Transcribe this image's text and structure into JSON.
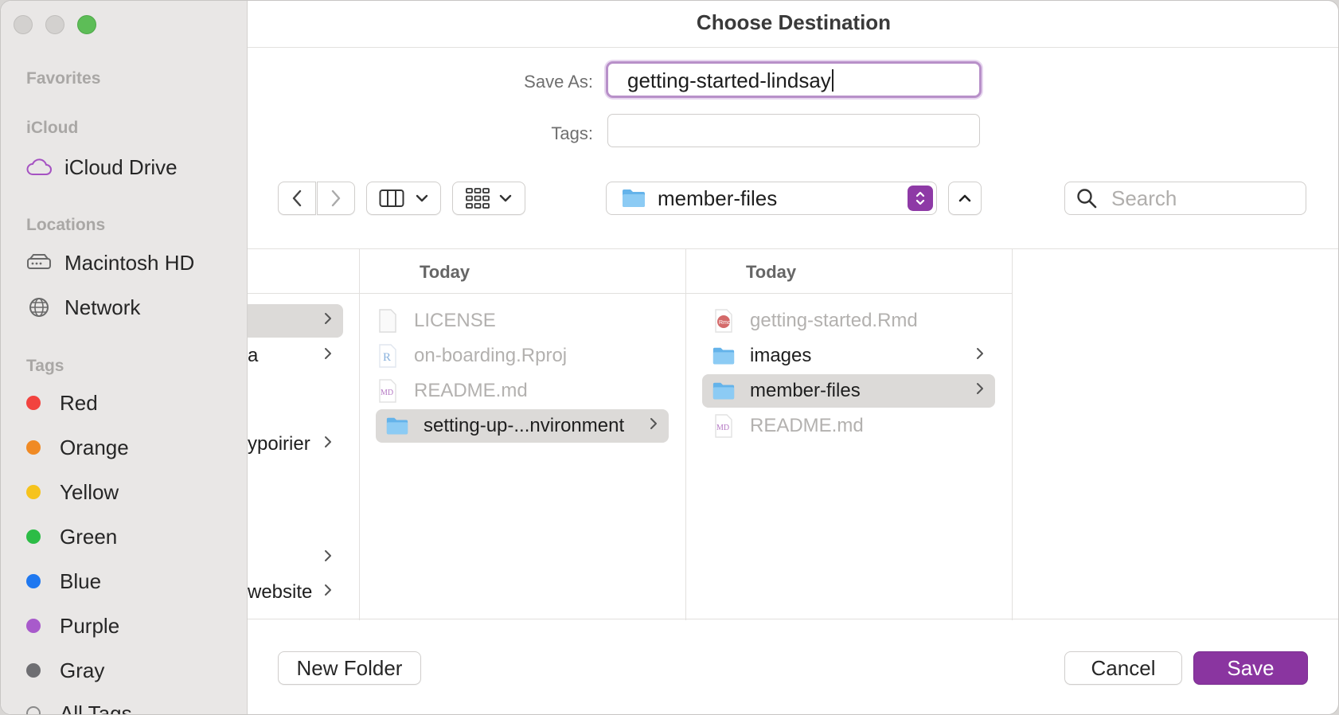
{
  "window": {
    "title": "Choose Destination"
  },
  "sidebar": {
    "sections": {
      "favorites": "Favorites",
      "icloud": "iCloud",
      "locations": "Locations",
      "tags": "Tags"
    },
    "icloud_items": [
      {
        "label": "iCloud Drive",
        "icon": "cloud-icon"
      }
    ],
    "location_items": [
      {
        "label": "Macintosh HD",
        "icon": "drive-icon"
      },
      {
        "label": "Network",
        "icon": "globe-icon"
      }
    ],
    "tag_items": [
      {
        "label": "Red",
        "color": "#f2433f"
      },
      {
        "label": "Orange",
        "color": "#f08a24"
      },
      {
        "label": "Yellow",
        "color": "#f6c31c"
      },
      {
        "label": "Green",
        "color": "#2cbc46"
      },
      {
        "label": "Blue",
        "color": "#1f78f0"
      },
      {
        "label": "Purple",
        "color": "#a85acb"
      },
      {
        "label": "Gray",
        "color": "#6e6e72"
      },
      {
        "label": "All Tags…"
      }
    ]
  },
  "form": {
    "save_as_label": "Save As:",
    "save_as_value": "getting-started-lindsay",
    "tags_label": "Tags:",
    "tags_value": ""
  },
  "toolbar": {
    "path_current": "member-files",
    "search_placeholder": "Search"
  },
  "browser": {
    "column0_rows": [
      {
        "label": "",
        "selected": true,
        "chevron": true
      },
      {
        "label": "a",
        "chevron": true
      },
      {
        "label": "ypoirier",
        "chevron": true
      },
      {
        "label": "",
        "chevron": true
      },
      {
        "label": "website",
        "chevron": true
      }
    ],
    "column1": {
      "header": "Today",
      "rows": [
        {
          "label": "LICENSE",
          "icon": "blank-file-icon",
          "dimmed": true
        },
        {
          "label": "on-boarding.Rproj",
          "icon": "r-project-icon",
          "dimmed": true
        },
        {
          "label": "README.md",
          "icon": "markdown-file-icon",
          "dimmed": true
        },
        {
          "label": "setting-up-...nvironment",
          "icon": "folder-icon",
          "selected": true,
          "chevron": true
        }
      ]
    },
    "column2": {
      "header": "Today",
      "rows": [
        {
          "label": "getting-started.Rmd",
          "icon": "rmd-file-icon",
          "dimmed": true
        },
        {
          "label": "images",
          "icon": "folder-icon",
          "chevron": true
        },
        {
          "label": "member-files",
          "icon": "folder-icon",
          "selected": true,
          "chevron": true
        },
        {
          "label": "README.md",
          "icon": "markdown-file-icon",
          "dimmed": true
        }
      ]
    }
  },
  "footer": {
    "new_folder": "New Folder",
    "cancel": "Cancel",
    "save": "Save"
  },
  "colors": {
    "accent": "#8a35a0"
  }
}
